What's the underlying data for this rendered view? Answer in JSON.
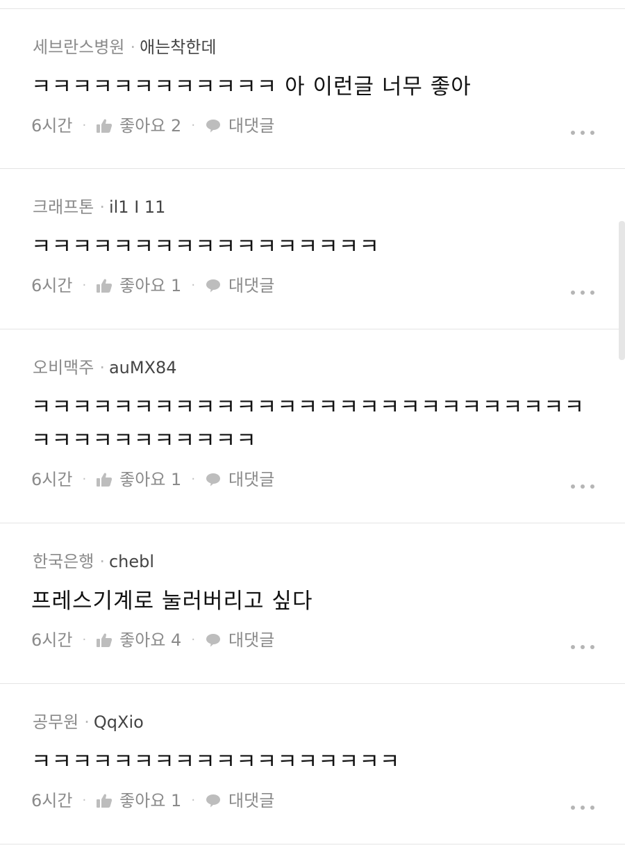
{
  "comments": [
    {
      "author_tag": "세브란스병원",
      "author_id": "애는착한데",
      "text": "ㅋㅋㅋㅋㅋㅋㅋㅋㅋㅋㅋㅋ 아 이런글 너무 좋아",
      "time": "6시간",
      "like_label": "좋아요 2",
      "reply_label": "대댓글"
    },
    {
      "author_tag": "크래프톤",
      "author_id": "il1 I 11",
      "text": "ㅋㅋㅋㅋㅋㅋㅋㅋㅋㅋㅋㅋㅋㅋㅋㅋㅋ",
      "time": "6시간",
      "like_label": "좋아요 1",
      "reply_label": "대댓글"
    },
    {
      "author_tag": "오비맥주",
      "author_id": "auMX84",
      "text": "ㅋㅋㅋㅋㅋㅋㅋㅋㅋㅋㅋㅋㅋㅋㅋㅋㅋㅋㅋㅋㅋㅋㅋㅋㅋㅋㅋ\nㅋㅋㅋㅋㅋㅋㅋㅋㅋㅋㅋ",
      "time": "6시간",
      "like_label": "좋아요 1",
      "reply_label": "대댓글"
    },
    {
      "author_tag": "한국은행",
      "author_id": "chebl",
      "text": "프레스기계로 눌러버리고 싶다",
      "time": "6시간",
      "like_label": "좋아요 4",
      "reply_label": "대댓글"
    },
    {
      "author_tag": "공무원",
      "author_id": "QqXio",
      "text": "ㅋㅋㅋㅋㅋㅋㅋㅋㅋㅋㅋㅋㅋㅋㅋㅋㅋㅋ",
      "time": "6시간",
      "like_label": "좋아요 1",
      "reply_label": "대댓글"
    }
  ],
  "separator_glyph": "·",
  "icons": {
    "like": "thumbs-up-icon",
    "reply": "speech-bubble-icon",
    "more": "more-dots-icon"
  },
  "colors": {
    "meta_gray": "#8a8a8a",
    "divider": "#e4e4e4",
    "text": "#111111"
  }
}
